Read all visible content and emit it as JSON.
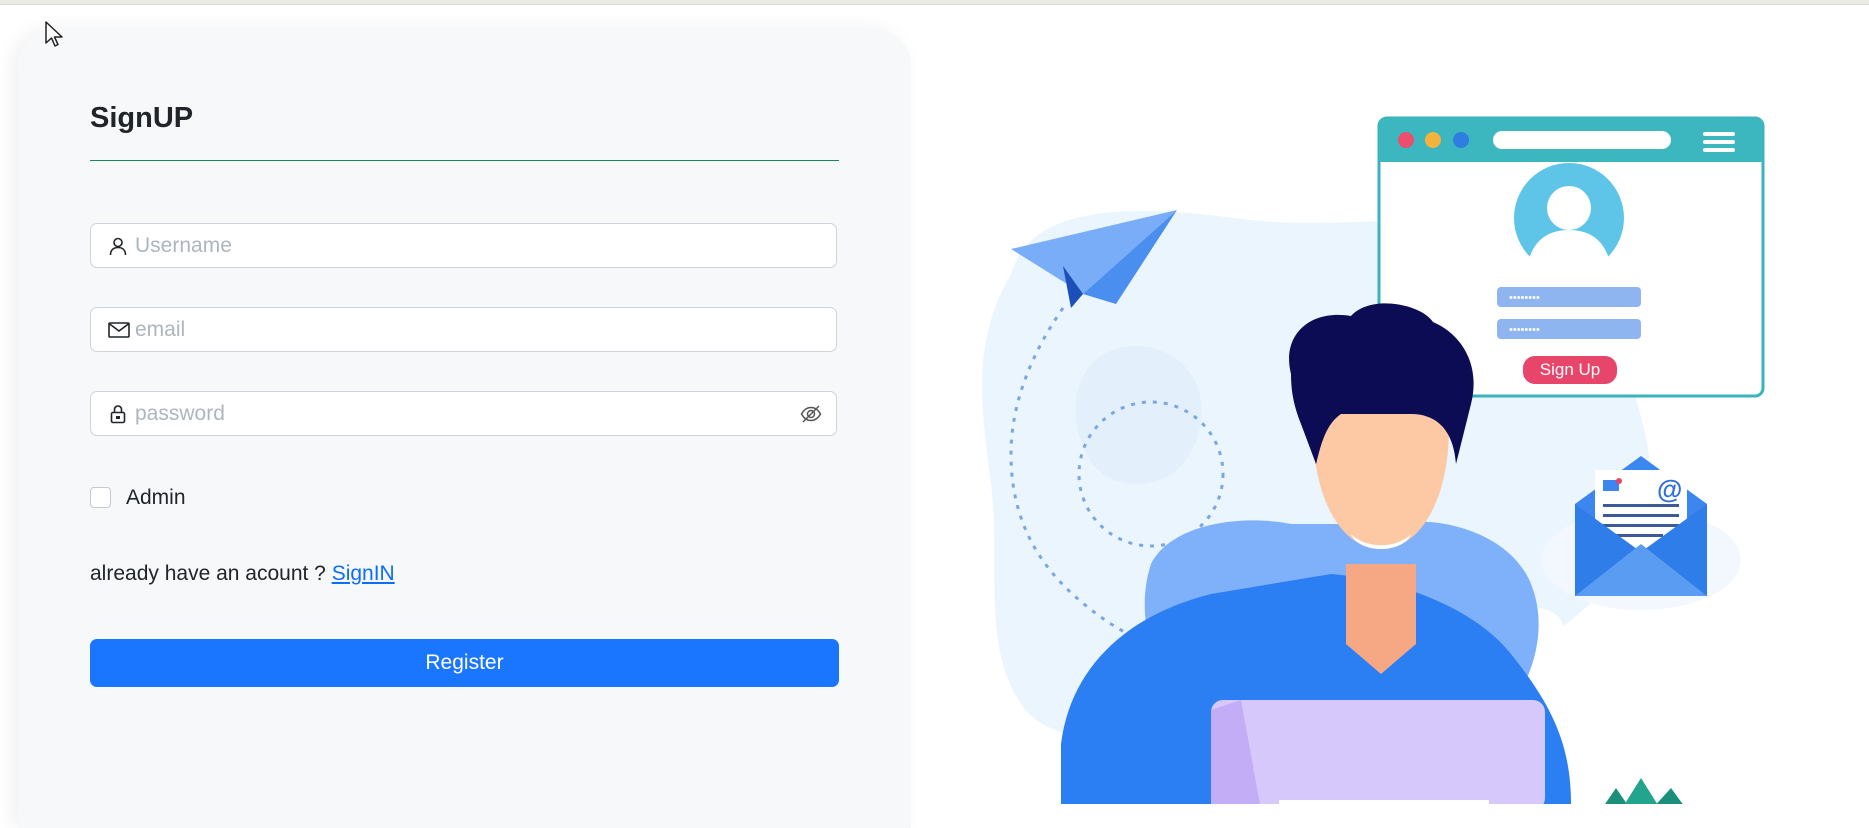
{
  "form": {
    "title": "SignUP",
    "username_placeholder": "Username",
    "email_placeholder": "email",
    "password_placeholder": "password",
    "admin_label": "Admin",
    "already_text": "already have an acount ? ",
    "signin_link": "SignIN",
    "register_label": "Register"
  },
  "illustration": {
    "signup_button_text": "Sign Up",
    "password_dots_1": "••••••••",
    "password_dots_2": "••••••••",
    "email_at": "@"
  },
  "icons": {
    "username": "user-icon",
    "email": "envelope-icon",
    "password": "lock-icon",
    "visibility": "eye-slash-icon",
    "cursor": "mouse-pointer-icon"
  },
  "colors": {
    "primary": "#1a75ff",
    "rule": "#198754",
    "link": "#0d6efd",
    "card_bg": "#f6f8fa"
  }
}
